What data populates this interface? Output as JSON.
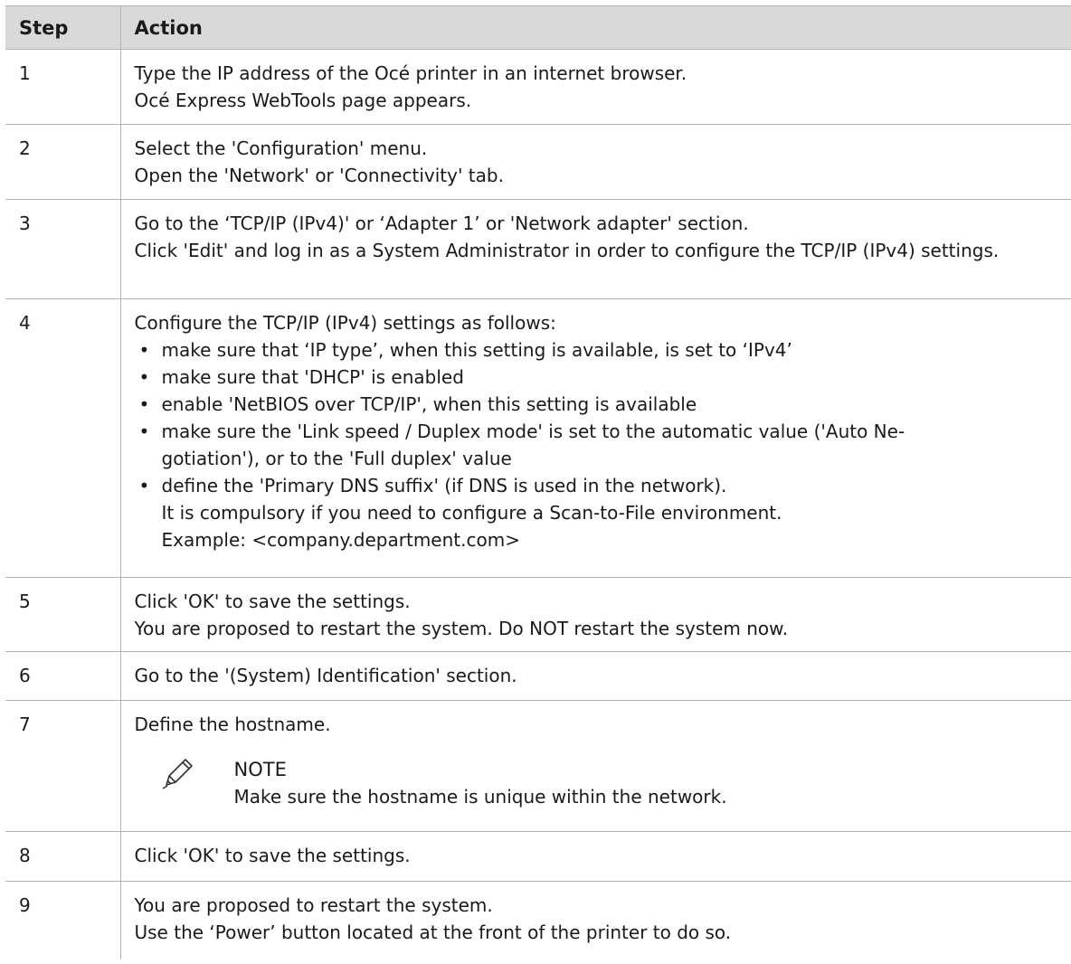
{
  "table": {
    "headers": {
      "step": "Step",
      "action": "Action"
    },
    "rows": [
      {
        "step": "1",
        "lines": [
          "Type the IP address of the Océ printer in an internet browser.",
          "Océ Express WebTools page appears."
        ]
      },
      {
        "step": "2",
        "lines": [
          "Select the 'Configuration' menu.",
          "Open the 'Network' or 'Connectivity' tab."
        ]
      },
      {
        "step": "3",
        "lines": [
          "Go to the ‘TCP/IP (IPv4)' or ‘Adapter 1’ or 'Network adapter' section.",
          "Click 'Edit' and log in as a System Administrator in order to configure the TCP/IP (IPv4) settings."
        ]
      },
      {
        "step": "4",
        "intro": "Configure the TCP/IP (IPv4) settings as follows:",
        "bullets": [
          "make sure that ‘IP type’, when this setting is available, is set to ‘IPv4’",
          "make sure that 'DHCP' is enabled",
          "enable 'NetBIOS over TCP/IP', when this setting is available",
          "make sure the 'Link speed / Duplex mode' is set to the automatic value ('Auto Ne-gotiation'), or to the 'Full duplex' value",
          "define the 'Primary DNS suffix' (if DNS is used in the network)."
        ],
        "bullet4_line1": "make sure the 'Link speed / Duplex mode' is set to the automatic value ('Auto Ne-",
        "bullet4_line2": "gotiation'), or to the 'Full duplex' value",
        "sub_lines": [
          "It is compulsory if you need to configure a Scan-to-File environment.",
          "Example: <company.department.com>"
        ]
      },
      {
        "step": "5",
        "lines": [
          "Click 'OK' to save the settings.",
          "You are proposed to restart the system. Do NOT restart the system now."
        ]
      },
      {
        "step": "6",
        "lines": [
          "Go to the '(System) Identification' section."
        ]
      },
      {
        "step": "7",
        "lines": [
          "Define the hostname."
        ],
        "note": {
          "icon": "pencil-icon",
          "title": "NOTE",
          "text": "Make sure the hostname is unique within the network."
        }
      },
      {
        "step": "8",
        "lines": [
          "Click 'OK' to save the settings."
        ]
      },
      {
        "step": "9",
        "lines": [
          "You are proposed to restart the system.",
          "Use the ‘Power’ button located at the front of the printer to do so."
        ]
      }
    ],
    "bullet_glyph": "•"
  },
  "colors": {
    "header_bg": "#d9d9d9",
    "border": "#b3b3b3",
    "text": "#1a1a1a"
  }
}
